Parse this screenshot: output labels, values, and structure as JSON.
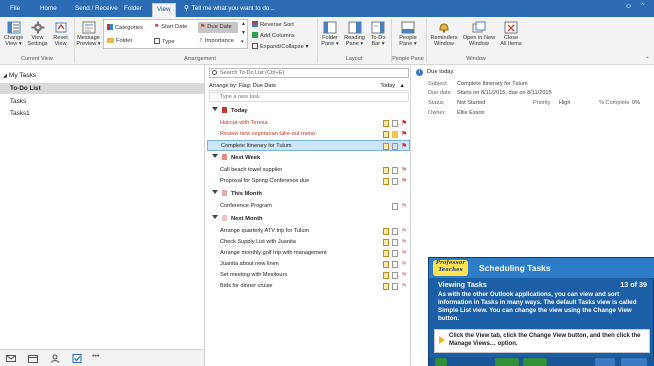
{
  "tabs": [
    "File",
    "Home",
    "Send / Receive",
    "Folder",
    "View"
  ],
  "active_tab": "View",
  "tell_me": "Tell me what you want to do...",
  "ribbon": {
    "current_view": {
      "change_view": [
        "Change",
        "View ▾"
      ],
      "view_settings": [
        "View",
        "Settings"
      ],
      "reset_view": [
        "Reset",
        "View"
      ],
      "label": "Current View"
    },
    "message_preview": [
      "Message",
      "Preview ▾"
    ],
    "arrangement": {
      "categories": "Categories",
      "start_date": "Start Date",
      "due_date": "Due Date",
      "folder": "Folder",
      "type": "Type",
      "importance": "Importance",
      "reverse_sort": "Reverse Sort",
      "add_columns": "Add Columns",
      "expand_collapse": "Expand/Collapse ▾",
      "label": "Arrangement"
    },
    "layout": {
      "folder_pane": [
        "Folder",
        "Pane ▾"
      ],
      "reading_pane": [
        "Reading",
        "Pane ▾"
      ],
      "todo_bar": [
        "To-Do",
        "Bar ▾"
      ],
      "label": "Layout"
    },
    "people_pane": {
      "people_pane": [
        "People",
        "Pane ▾"
      ],
      "label": "People Pane"
    },
    "window": {
      "reminders": [
        "Reminders",
        "Window"
      ],
      "open_new": [
        "Open in New",
        "Window"
      ],
      "close_all": [
        "Close",
        "All Items"
      ],
      "label": "Window"
    }
  },
  "folders": {
    "header": "My Tasks",
    "items": [
      "To-Do List",
      "Tasks",
      "Tasks1"
    ],
    "selected": "To-Do List"
  },
  "list": {
    "search_placeholder": "Search To-Do List (Ctrl+E)",
    "arrange_label": "Arrange by: Flag: Due Date",
    "arrange_sort": "Today",
    "new_task_placeholder": "Type a new task",
    "groups": [
      {
        "name": "Today",
        "tasks": [
          "Haircut with Teresa",
          "Review new vegetarian take-out menu",
          "Complete Itinerary for Tulum"
        ]
      },
      {
        "name": "Next Week",
        "tasks": [
          "Call beach towel supplier",
          "Proposal for Spring Conference due"
        ]
      },
      {
        "name": "This Month",
        "tasks": [
          "Conference Program"
        ]
      },
      {
        "name": "Next Month",
        "tasks": [
          "Arrange quarterly ATV trip for Tulum",
          "Check Supply List with Juanita",
          "Arrange monthly golf trip with management",
          "Juanita about new linen",
          "Set meeting with Mexitours",
          "Bids for dinner cruise"
        ]
      }
    ]
  },
  "reading": {
    "note": "Due today.",
    "subject_key": "Subject",
    "subject_val": "Complete Itinerary for Tulum",
    "due_key": "Due date",
    "due_val": "Starts on 8/11/2015, due on 8/11/2015",
    "status_key": "Status",
    "status_val": "Not Started",
    "priority_key": "Priority",
    "priority_val": "High",
    "complete_key": "% Complete",
    "complete_val": "0%",
    "owner_key": "Owner",
    "owner_val": "Ellie Exson"
  },
  "tutorial": {
    "logo": [
      "Professor",
      "Teaches"
    ],
    "title": "Scheduling Tasks",
    "subtitle": "Viewing Tasks",
    "counter": "13 of 39",
    "body": "As with the other Outlook applications, you can view and sort information in Tasks in many ways. The default Tasks view is called Simple List view. You can change the view using the Change View button.",
    "step": "Click the View tab, click the Change View button, and then click the Manage Views… option."
  },
  "colors": {
    "accent": "#2b6cb5",
    "overdue": "#c0392b",
    "selected_row": "#cde6f7",
    "tutorial_bg": "#1c5fa6"
  }
}
